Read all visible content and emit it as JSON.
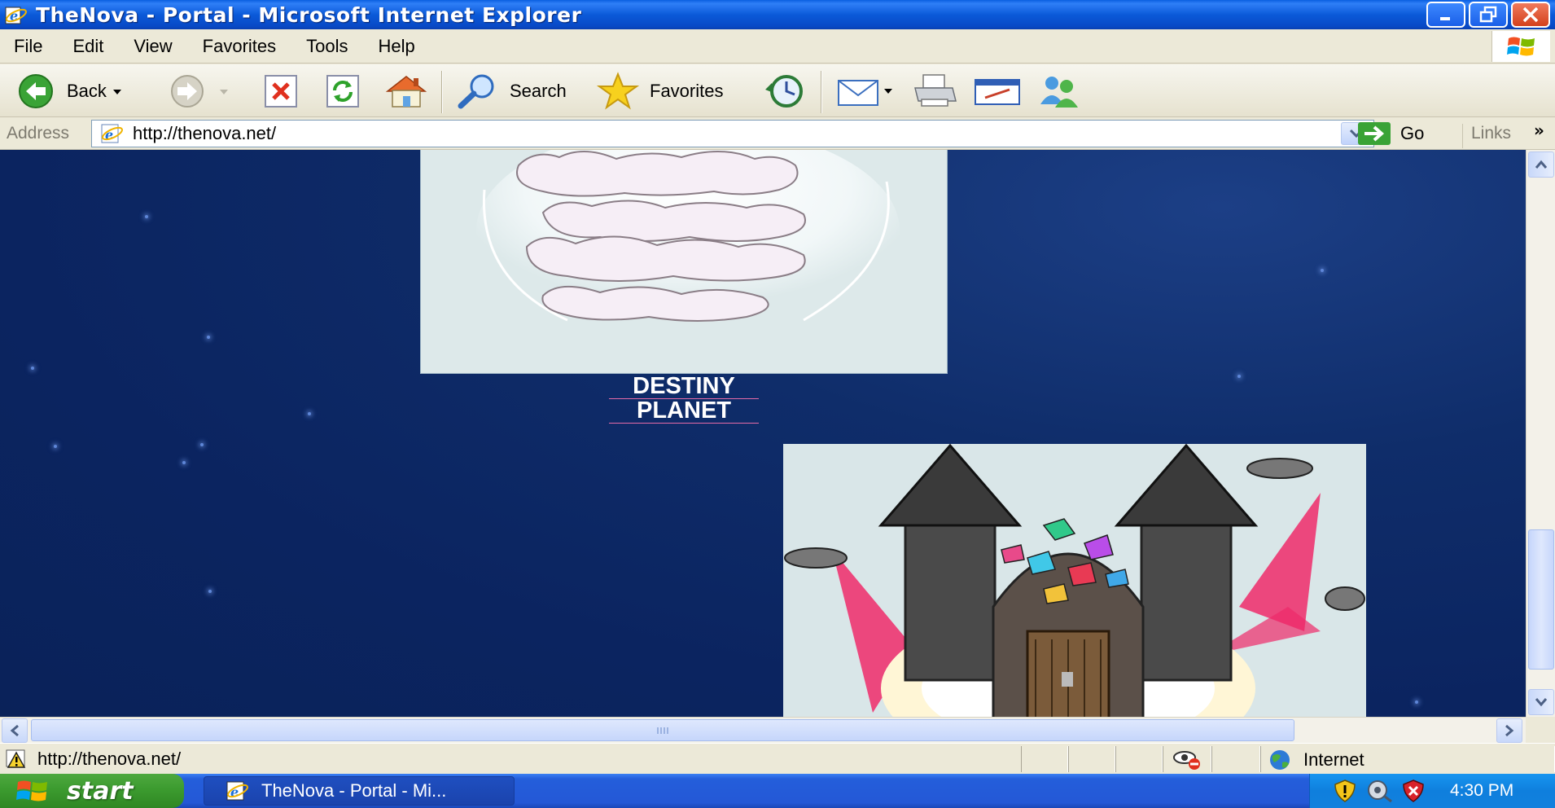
{
  "window": {
    "title": "TheNova - Portal - Microsoft Internet Explorer"
  },
  "menu": [
    "File",
    "Edit",
    "View",
    "Favorites",
    "Tools",
    "Help"
  ],
  "toolbar": {
    "back_label": "Back",
    "search_label": "Search",
    "favorites_label": "Favorites"
  },
  "address": {
    "label": "Address",
    "url": "http://thenova.net/",
    "go_label": "Go",
    "links_label": "Links"
  },
  "content": {
    "caption_line1": "DESTINY",
    "caption_line2": "PLANET"
  },
  "status": {
    "text": "http://thenova.net/",
    "zone": "Internet"
  },
  "taskbar": {
    "start_label": "start",
    "task_label": "TheNova - Portal - Mi...",
    "clock": "4:30 PM"
  },
  "colors": {
    "title_bar": "#0a5fe0",
    "page_background": "#0b2460",
    "caption_underline": "#e46aa7",
    "start_button": "#3c9b2f"
  }
}
